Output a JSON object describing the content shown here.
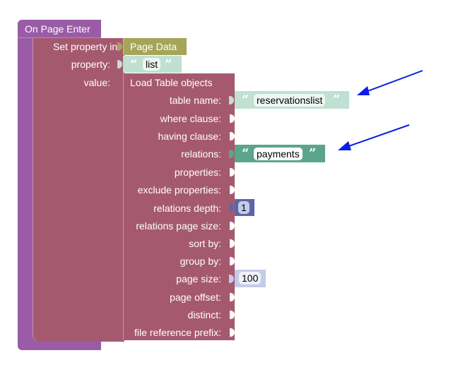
{
  "event_block": {
    "label": "On Page Enter",
    "color": "#9a5ca6"
  },
  "set_block": {
    "label": "Set property in:",
    "property_label": "property:",
    "value_label": "value:",
    "color": "#a5596f"
  },
  "page_data": {
    "label": "Page Data",
    "color": "#a5a55a"
  },
  "property_value": {
    "quote_open": "“",
    "text": "list",
    "quote_close": "”",
    "color": "#bfe0d2"
  },
  "load_block": {
    "title": "Load Table objects",
    "color": "#a5596f",
    "params": [
      {
        "label": "table name:"
      },
      {
        "label": "where clause:"
      },
      {
        "label": "having clause:"
      },
      {
        "label": "relations:"
      },
      {
        "label": "properties:"
      },
      {
        "label": "exclude properties:"
      },
      {
        "label": "relations depth:"
      },
      {
        "label": "relations page size:"
      },
      {
        "label": "sort by:"
      },
      {
        "label": "group by:"
      },
      {
        "label": "page size:"
      },
      {
        "label": "page offset:"
      },
      {
        "label": "distinct:"
      },
      {
        "label": "file reference prefix:"
      }
    ]
  },
  "table_name_value": {
    "quote_open": "“",
    "text": "reservationslist",
    "quote_close": "”",
    "color": "#bfe0d2"
  },
  "relations_value": {
    "quote_open": "“",
    "text": "payments",
    "quote_close": "”",
    "color": "#5ba58c"
  },
  "relations_depth_value": {
    "text": "1",
    "color": "#5b67a5"
  },
  "page_size_value": {
    "text": "100",
    "color": "#c5cbe8"
  },
  "arrow_color": "#0a1ee6"
}
